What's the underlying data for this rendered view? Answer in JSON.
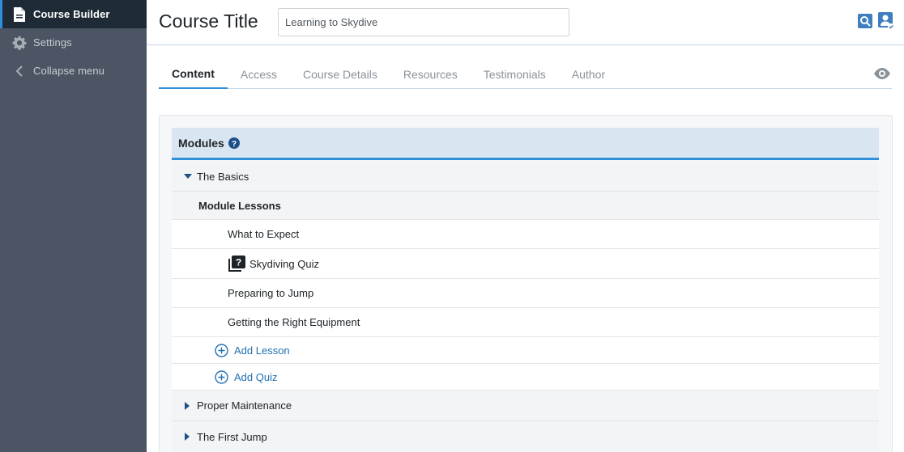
{
  "sidebar": {
    "items": [
      {
        "label": "Course Builder",
        "icon": "document-icon",
        "active": true
      },
      {
        "label": "Settings",
        "icon": "gear-icon",
        "active": false
      },
      {
        "label": "Collapse menu",
        "icon": "chevron-left-icon",
        "active": false
      }
    ]
  },
  "header": {
    "title": "Course Title",
    "title_input_value": "Learning to Skydive",
    "icons": [
      "search-page-icon",
      "user-check-icon"
    ]
  },
  "tabs": [
    {
      "label": "Content",
      "active": true
    },
    {
      "label": "Access",
      "active": false
    },
    {
      "label": "Course Details",
      "active": false
    },
    {
      "label": "Resources",
      "active": false
    },
    {
      "label": "Testimonials",
      "active": false
    },
    {
      "label": "Author",
      "active": false
    }
  ],
  "preview_icon": "eye-icon",
  "modules": {
    "title": "Modules",
    "help_icon": "help-icon",
    "list": [
      {
        "name": "The Basics",
        "expanded": true,
        "section_label": "Module Lessons",
        "lessons": [
          {
            "title": "What to Expect",
            "type": "lesson"
          },
          {
            "title": "Skydiving Quiz",
            "type": "quiz"
          },
          {
            "title": "Preparing to Jump",
            "type": "lesson"
          },
          {
            "title": "Getting the Right Equipment",
            "type": "lesson"
          }
        ],
        "add_lesson_label": "Add Lesson",
        "add_quiz_label": "Add Quiz"
      },
      {
        "name": "Proper Maintenance",
        "expanded": false
      },
      {
        "name": "The First Jump",
        "expanded": false
      }
    ]
  },
  "colors": {
    "sidebar_bg": "#4b5563",
    "sidebar_active_bg": "#1f2a37",
    "accent": "#2f8fd8",
    "link": "#2271b1",
    "module_header_bg": "#d9e5f1"
  }
}
